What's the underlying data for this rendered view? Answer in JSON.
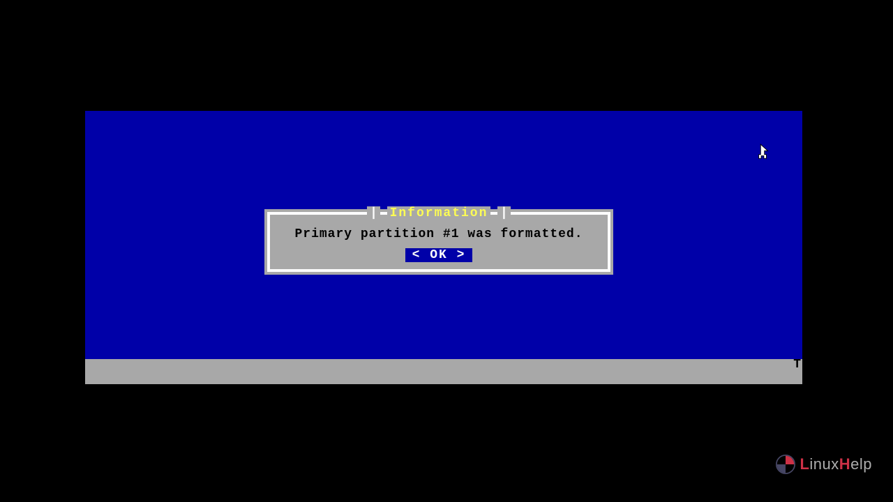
{
  "dialog": {
    "title": "Information",
    "message": "Primary partition #1 was formatted.",
    "ok_label": "< OK >"
  },
  "statusbar": {
    "right_indicator": "T"
  },
  "watermark": {
    "text_prefix": "L",
    "text_mid": "inux",
    "text_h": "H",
    "text_suffix": "elp"
  },
  "colors": {
    "screen_bg": "#0000a8",
    "dialog_bg": "#a8a8a8",
    "dialog_border": "#fcfcfc",
    "title_fg": "#fcfc54",
    "ok_bg": "#0000a8",
    "ok_fg": "#fcfcfc"
  }
}
